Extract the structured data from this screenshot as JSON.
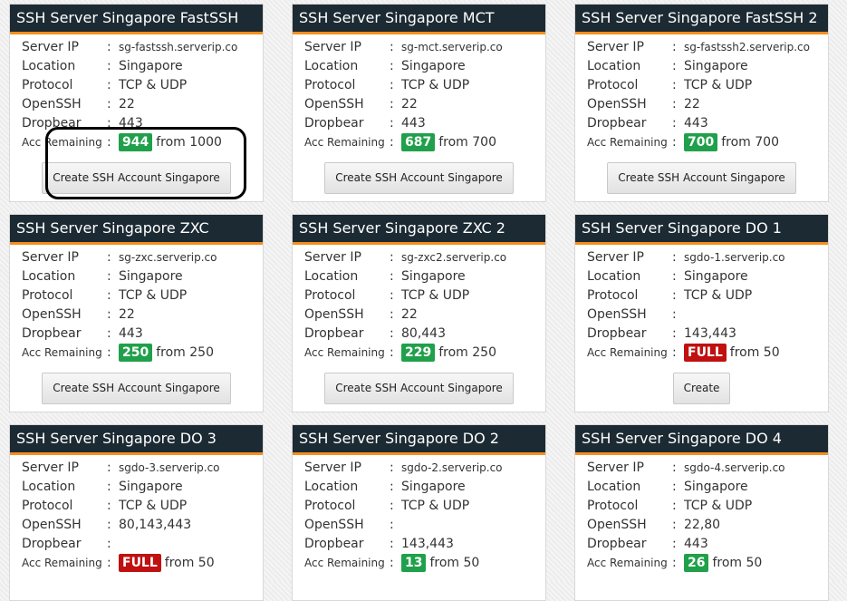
{
  "labels": {
    "server_ip": "Server IP",
    "location": "Location",
    "protocol": "Protocol",
    "openssh": "OpenSSH",
    "dropbear": "Dropbear",
    "acc_remaining": "Acc Remaining",
    "colon": ":",
    "from_prefix": "from"
  },
  "servers": [
    {
      "title": "SSH Server Singapore FastSSH",
      "ip": "sg-fastssh.serverip.co",
      "location": "Singapore",
      "protocol": "TCP & UDP",
      "openssh": "22",
      "dropbear": "443",
      "remaining": "944",
      "remaining_color": "#20a04a",
      "from": "from 1000",
      "button": "Create SSH Account Singapore"
    },
    {
      "title": "SSH Server Singapore MCT",
      "ip": "sg-mct.serverip.co",
      "location": "Singapore",
      "protocol": "TCP & UDP",
      "openssh": "22",
      "dropbear": "443",
      "remaining": "687",
      "remaining_color": "#20a04a",
      "from": "from 700",
      "button": "Create SSH Account Singapore"
    },
    {
      "title": "SSH Server Singapore FastSSH 2",
      "ip": "sg-fastssh2.serverip.co",
      "location": "Singapore",
      "protocol": "TCP & UDP",
      "openssh": "22",
      "dropbear": "443",
      "remaining": "700",
      "remaining_color": "#20a04a",
      "from": "from 700",
      "button": "Create SSH Account Singapore"
    },
    {
      "title": "SSH Server Singapore ZXC",
      "ip": "sg-zxc.serverip.co",
      "location": "Singapore",
      "protocol": "TCP & UDP",
      "openssh": "22",
      "dropbear": "443",
      "remaining": "250",
      "remaining_color": "#20a04a",
      "from": "from 250",
      "button": "Create SSH Account Singapore"
    },
    {
      "title": "SSH Server Singapore ZXC 2",
      "ip": "sg-zxc2.serverip.co",
      "location": "Singapore",
      "protocol": "TCP & UDP",
      "openssh": "22",
      "dropbear": "80,443",
      "remaining": "229",
      "remaining_color": "#20a04a",
      "from": "from 250",
      "button": "Create SSH Account Singapore"
    },
    {
      "title": "SSH Server Singapore DO 1",
      "ip": "sgdo-1.serverip.co",
      "location": "Singapore",
      "protocol": "TCP & UDP",
      "openssh": "",
      "dropbear": "143,443",
      "remaining": "FULL",
      "remaining_color": "#c01010",
      "from": "from 50",
      "button": "Create"
    },
    {
      "title": "SSH Server Singapore DO 3",
      "ip": "sgdo-3.serverip.co",
      "location": "Singapore",
      "protocol": "TCP & UDP",
      "openssh": "80,143,443",
      "dropbear": "",
      "remaining": "FULL",
      "remaining_color": "#c01010",
      "from": "from 50",
      "button": ""
    },
    {
      "title": "SSH Server Singapore DO 2",
      "ip": "sgdo-2.serverip.co",
      "location": "Singapore",
      "protocol": "TCP & UDP",
      "openssh": "",
      "dropbear": "143,443",
      "remaining": "13",
      "remaining_color": "#20a04a",
      "from": "from 50",
      "button": ""
    },
    {
      "title": "SSH Server Singapore DO 4",
      "ip": "sgdo-4.serverip.co",
      "location": "Singapore",
      "protocol": "TCP & UDP",
      "openssh": "22,80",
      "dropbear": "443",
      "remaining": "26",
      "remaining_color": "#20a04a",
      "from": "from 50",
      "button": ""
    }
  ],
  "colors": {
    "header_bg": "#1c2a33",
    "header_accent": "#f58e1f",
    "badge_green": "#20a04a",
    "badge_red": "#c01010"
  }
}
